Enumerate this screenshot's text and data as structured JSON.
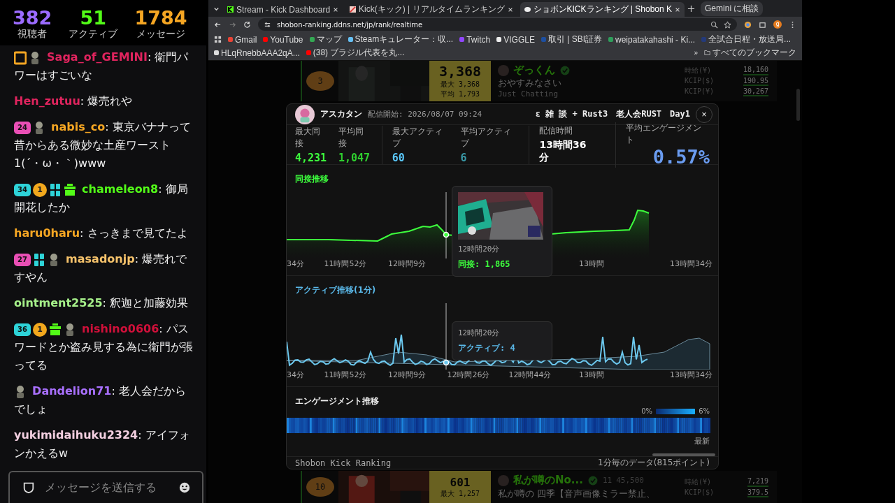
{
  "chat": {
    "stats": [
      {
        "value": "382",
        "label": "視聴者",
        "color": "#9b6bff"
      },
      {
        "value": "51",
        "label": "アクティブ",
        "color": "#53fc18"
      },
      {
        "value": "1784",
        "label": "メッセージ",
        "color": "#f5a623"
      }
    ],
    "messages": [
      {
        "badges": [
          {
            "kind": "square"
          },
          {
            "kind": "figure"
          }
        ],
        "user": "Saga_of_GEMINI",
        "color": "#e0245e",
        "text": ": 衛門パワーはすごいな"
      },
      {
        "user": "Hen_zutuu",
        "color": "#e0245e",
        "text": ": 爆売れや"
      },
      {
        "badges": [
          {
            "kind": "sub",
            "text": "24",
            "color": "#e94fb5"
          },
          {
            "kind": "figure"
          }
        ],
        "user": "nabis_co",
        "color": "#f5a623",
        "text": ": 東京バナナって昔からある微妙な土産ワースト1(´・ω・｀)www"
      },
      {
        "badges": [
          {
            "kind": "sub",
            "text": "34",
            "color": "#2ed3d8"
          },
          {
            "kind": "coin",
            "text": "1"
          },
          {
            "kind": "og"
          },
          {
            "kind": "gift"
          }
        ],
        "user": "chameleon8",
        "color": "#53fc18",
        "text": ": 御局開花したか"
      },
      {
        "user": "haru0haru",
        "color": "#f5a623",
        "text": ": さっきまで見てたよ"
      },
      {
        "badges": [
          {
            "kind": "sub",
            "text": "27",
            "color": "#e94fb5"
          },
          {
            "kind": "og"
          },
          {
            "kind": "figure"
          }
        ],
        "user": "masadonjp",
        "color": "#f5c26b",
        "text": ": 爆売れですやん"
      },
      {
        "user": "ointment2525",
        "color": "#a6f08a",
        "text": ": 釈迦と加藤効果"
      },
      {
        "badges": [
          {
            "kind": "sub",
            "text": "36",
            "color": "#2ed3d8"
          },
          {
            "kind": "coin",
            "text": "1"
          },
          {
            "kind": "gift"
          },
          {
            "kind": "figure"
          }
        ],
        "user": "nishino0606",
        "color": "#d0103a",
        "text": ": パスワードとか盗み見する為に衛門が張ってる"
      },
      {
        "badges": [
          {
            "kind": "figure"
          }
        ],
        "user": "Dandelion71",
        "color": "#a970ff",
        "text": ": 老人会だからでしょ"
      },
      {
        "user": "yukimidaihuku2324",
        "color": "#f3cfe0",
        "text": ": アイフォンかえるw"
      }
    ],
    "input": {
      "placeholder": "メッセージを送信する"
    }
  },
  "browser": {
    "tabs": [
      {
        "kind": "kick",
        "title": "Stream - Kick Dashboard",
        "selected": false
      },
      {
        "kind": "ranking",
        "title": "Kick(キック) | リアルタイムランキング",
        "selected": false
      },
      {
        "kind": "shobon",
        "title": "ショボンKICKランキング | Shobon K",
        "selected": true
      }
    ],
    "gemini_button": "Gemini に相談",
    "profile": "g",
    "address": "shobon-ranking.ddns.net/jp/rank/realtime",
    "bookmarks": [
      {
        "title": "Gmail",
        "color": "#ea4335"
      },
      {
        "title": "YouTube",
        "color": "#ff0000"
      },
      {
        "title": "マップ",
        "color": "#34a853"
      },
      {
        "title": "Steamキュレーター：収...",
        "color": "#66c0f4"
      },
      {
        "title": "Twitch",
        "color": "#9146ff"
      },
      {
        "title": "VIGGLE",
        "color": "#eeeeee"
      },
      {
        "title": "取引 | SBI証券",
        "color": "#1d4fa0"
      },
      {
        "title": "weipatakahashi - Ki...",
        "color": "#2e9e5b"
      },
      {
        "title": "全試合日程・放送局...",
        "color": "#243a7a"
      },
      {
        "title": "HLqRnebbAAA2qA...",
        "color": "#dddddd"
      },
      {
        "title": "(38) ブラジル代表を丸...",
        "color": "#ff0000"
      }
    ],
    "more_bookmarks": "»",
    "all_bookmarks": "すべてのブックマーク"
  },
  "background_rows": [
    {
      "rank": "3",
      "count": "3,368",
      "max_label": "最大",
      "max": "3,368",
      "avg_label": "平均",
      "avg": "1,793",
      "name": "ぞっくん",
      "title": "おやすみなさい",
      "category": "Just Chatting",
      "stats": [
        {
          "label": "時給(¥)",
          "value": "18,160"
        },
        {
          "label": "KCIP($)",
          "value": "190.95"
        },
        {
          "label": "KCIP(¥)",
          "value": "30,267"
        }
      ]
    },
    {
      "rank": "10",
      "count": "601",
      "max_label": "最大",
      "max": "1,257",
      "name": "私が噂のNo...",
      "title": "私が噂の 四季【音声画像ミラー禁止、",
      "subs": "11",
      "kicks": "45,500",
      "stats": [
        {
          "label": "時給(¥)",
          "value": "7,219"
        },
        {
          "label": "KCIP($)",
          "value": "379.5"
        }
      ]
    }
  ],
  "modal": {
    "streamer": "アスカタン",
    "start": "配信開始: 2026/08/07 09:24",
    "stream_title": "ε 雑 談 + Rust3　老人会RUST　Day1",
    "close": "×",
    "stat_groups": [
      [
        {
          "label": "最大同接",
          "value": "4,231",
          "color": "#3dff3d"
        },
        {
          "label": "平均同接",
          "value": "1,047",
          "color": "#2fcf2f"
        }
      ],
      [
        {
          "label": "最大アクティブ",
          "value": "60",
          "color": "#5ac8fa"
        },
        {
          "label": "平均アクティブ",
          "value": "6",
          "color": "#3a9aa8"
        }
      ],
      [
        {
          "label": "配信時間",
          "value": "13時間36分",
          "color": "#ffffff"
        }
      ]
    ],
    "engagement_stat": {
      "label": "平均エンゲージメント",
      "value": "0.57%"
    },
    "viewer_chart": {
      "title": "同接推移",
      "x_labels": [
        "34分",
        "11時間52分",
        "12時間9分",
        "13時間",
        "13時間34分"
      ],
      "tooltip": {
        "time": "12時間20分",
        "reading": "同接: 1,865"
      }
    },
    "active_chart": {
      "title": "アクティブ推移(1分)",
      "x_labels": [
        "34分",
        "11時間52分",
        "12時間9分",
        "12時間26分",
        "12時間44分",
        "13時間",
        "13時間34分"
      ],
      "tooltip": {
        "time": "12時間20分",
        "reading": "アクティブ: 4"
      }
    },
    "engagement": {
      "title": "エンゲージメント推移",
      "legend_min": "0%",
      "legend_max": "6%",
      "latest": "最新"
    },
    "footer": {
      "brand": "Shobon Kick Ranking",
      "note": "1分毎のデータ(815ポイント)"
    }
  }
}
